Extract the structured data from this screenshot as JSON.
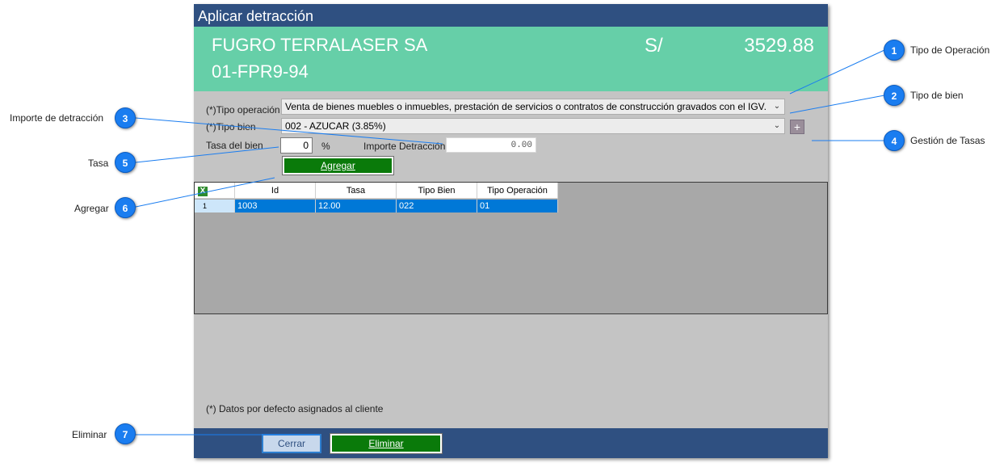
{
  "window": {
    "title": "Aplicar detracción"
  },
  "header": {
    "customer_name": "FUGRO TERRALASER SA",
    "document": "01-FPR9-94",
    "currency": "S/",
    "amount": "3529.88"
  },
  "form": {
    "tipo_operacion_label": "(*)Tipo operación",
    "tipo_operacion_value": "Venta de bienes muebles o inmuebles, prestación de  servicios o contratos de construcción gravados con el IGV.",
    "tipo_bien_label": "(*)Tipo bien",
    "tipo_bien_value": "002 - AZUCAR (3.85%)",
    "tasa_label": "Tasa del bien",
    "tasa_value": "0",
    "percent": "%",
    "importe_label": "Importe Detracción",
    "importe_value": "0.00",
    "add_rate_symbol": "+",
    "agregar_button": "Agregar",
    "note": "(*) Datos por defecto asignados al cliente"
  },
  "grid": {
    "columns": [
      "Id",
      "Tasa",
      "Tipo Bien",
      "Tipo Operación"
    ],
    "rows": [
      {
        "num": "1",
        "id": "1003",
        "tasa": "12.00",
        "tipo_bien": "022",
        "tipo_operacion": "01"
      }
    ]
  },
  "footer": {
    "cerrar_button": "Cerrar",
    "eliminar_button": "Eliminar"
  },
  "callouts": [
    {
      "num": "1",
      "label": "Tipo de Operación"
    },
    {
      "num": "2",
      "label": "Tipo de bien"
    },
    {
      "num": "3",
      "label": "Importe de detracción"
    },
    {
      "num": "4",
      "label": "Gestión de Tasas"
    },
    {
      "num": "5",
      "label": "Tasa"
    },
    {
      "num": "6",
      "label": "Agregar"
    },
    {
      "num": "7",
      "label": "Eliminar"
    }
  ],
  "colors": {
    "titlebar": "#2f5081",
    "header": "#66cfa8",
    "button_green": "#0a7a0a",
    "selection": "#0078d7",
    "callout": "#1a7df0"
  }
}
